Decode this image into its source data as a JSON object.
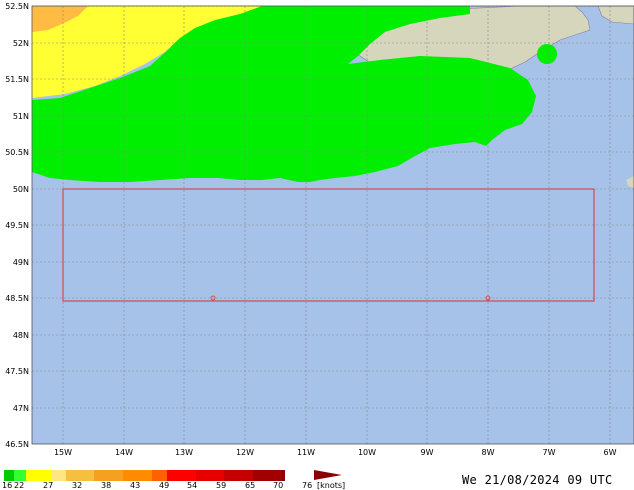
{
  "map": {
    "ocean_color": "#a6c2e8",
    "land_color": "#d6d6bc",
    "lat_labels": [
      "52.5N",
      "52N",
      "51.5N",
      "51N",
      "50.5N",
      "50N",
      "49.5N",
      "49N",
      "48.5N",
      "48N",
      "47.5N",
      "47N",
      "46.5N"
    ],
    "lon_labels": [
      "15W",
      "14W",
      "13W",
      "12W",
      "11W",
      "10W",
      "9W",
      "8W",
      "7W",
      "6W"
    ],
    "region_box_color": "#e03030",
    "wind_fill": {
      "band_16_22": "#00ee00",
      "band_22_27": "#ffff33",
      "band_27_32": "#ffbb44"
    }
  },
  "legend": {
    "colors": [
      "#00cc00",
      "#33ff33",
      "#ffff00",
      "#ffe680",
      "#f5c040",
      "#f5a020",
      "#ff8c00",
      "#ff6000",
      "#ff0000",
      "#e60000",
      "#c40000",
      "#a00000",
      "#900000"
    ],
    "labels": [
      "16",
      "22",
      "27",
      "32",
      "38",
      "43",
      "49",
      "54",
      "59",
      "65",
      "70",
      "76"
    ],
    "unit": "[knots]"
  },
  "timestamp": "We 21/08/2024 09 UTC"
}
